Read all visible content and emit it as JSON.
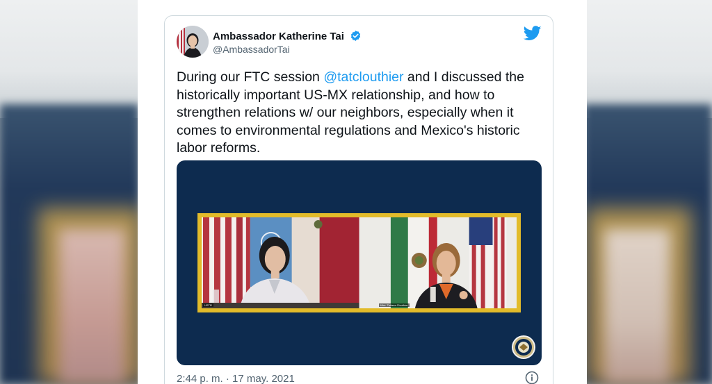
{
  "tweet": {
    "display_name": "Ambassador Katherine Tai",
    "handle": "@AmbassadorTai",
    "text_before": "During our FTC session ",
    "mention": "@tatclouthier",
    "text_after": " and I discussed the historically important US-MX relationship, and how to strengthen relations w/ our neighbors, especially when it comes to environmental regulations and Mexico's historic labor reforms.",
    "timestamp": "2:44 p. m. · 17 may. 2021",
    "icons": {
      "verified": "verified-badge-icon",
      "logo": "twitter-bird-icon",
      "info": "info-icon"
    }
  },
  "media": {
    "caption_left": "USTR",
    "caption_right": "Mtra. Tatiana Clouthier"
  },
  "colors": {
    "accent": "#1d9bf0",
    "media_bg": "#0d2b4f",
    "frame": "#e2bb2a"
  }
}
